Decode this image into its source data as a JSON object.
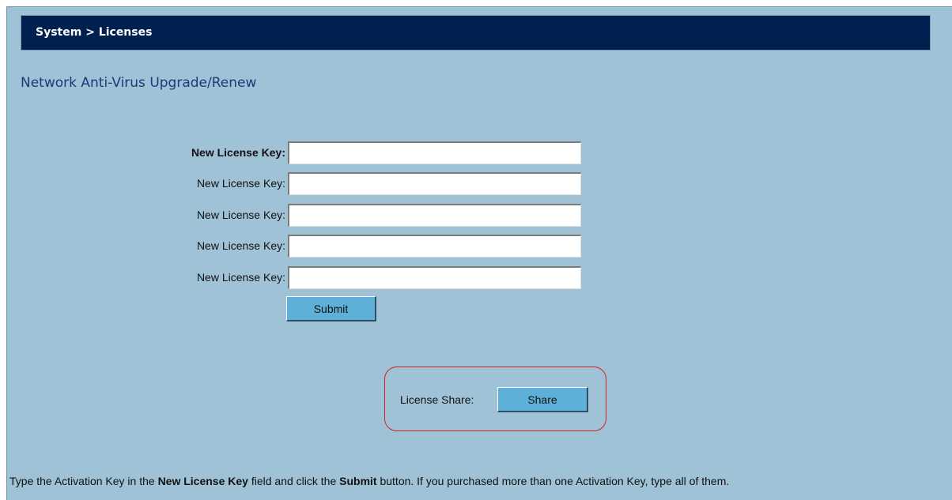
{
  "header": {
    "breadcrumb": "System > Licenses"
  },
  "page": {
    "section_title": "Network Anti-Virus Upgrade/Renew"
  },
  "license_form": {
    "rows": [
      {
        "label": "New License Key:",
        "value": ""
      },
      {
        "label": "New License Key:",
        "value": ""
      },
      {
        "label": "New License Key:",
        "value": ""
      },
      {
        "label": "New License Key:",
        "value": ""
      },
      {
        "label": "New License Key:",
        "value": ""
      }
    ],
    "submit_label": "Submit"
  },
  "license_share": {
    "label": "License Share:",
    "button_label": "Share"
  },
  "footer": {
    "part1": "Type the Activation Key in the ",
    "bold1": "New License Key",
    "part2": " field and click the ",
    "bold2": "Submit",
    "part3": " button. If you purchased more than one Activation Key, type all of them."
  },
  "colors": {
    "header_background": "#002050",
    "page_background": "#9fc2d6",
    "button_background": "#5fb0d8",
    "highlight_border": "#cc2222",
    "section_title": "#1b3b78"
  }
}
